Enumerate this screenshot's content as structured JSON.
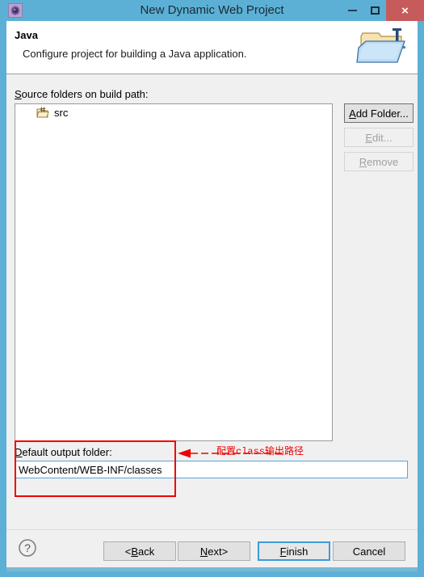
{
  "window": {
    "title": "New Dynamic Web Project",
    "app_icon": "gear-icon",
    "titlebar_color": "#5cb0d6",
    "controls": {
      "minimize": "–",
      "maximize": "□",
      "close": "×",
      "close_color": "#c75b5b"
    }
  },
  "header": {
    "title": "Java",
    "description": "Configure project for building a Java application.",
    "icon": "java-folder-icon"
  },
  "main": {
    "source_label_prefix": "S",
    "source_label_rest": "ource folders on build path:",
    "list": {
      "items": [
        {
          "label": "src",
          "icon": "package-folder-icon"
        }
      ]
    },
    "side_buttons": [
      {
        "name": "add-folder",
        "prefix": "A",
        "rest": "dd Folder...",
        "enabled": true
      },
      {
        "name": "edit",
        "prefix": "E",
        "rest": "dit...",
        "enabled": false
      },
      {
        "name": "remove",
        "prefix": "R",
        "rest": "emove",
        "enabled": false
      }
    ],
    "output": {
      "label_prefix": "D",
      "label_rest": "efault output folder:",
      "value": "WebContent/WEB-INF/classes"
    }
  },
  "annotation": {
    "text": "配置class输出路径",
    "color": "#ee0000"
  },
  "footer": {
    "help": "?",
    "buttons": [
      {
        "name": "back",
        "pre": "< ",
        "prefix": "B",
        "rest": "ack",
        "post": "",
        "default": false
      },
      {
        "name": "next",
        "pre": "",
        "prefix": "N",
        "rest": "ext",
        "post": " >",
        "default": false
      },
      {
        "name": "finish",
        "pre": "",
        "prefix": "F",
        "rest": "inish",
        "post": "",
        "default": true
      },
      {
        "name": "cancel",
        "pre": "",
        "prefix": "",
        "rest": "Cancel",
        "post": "",
        "default": false
      }
    ]
  }
}
